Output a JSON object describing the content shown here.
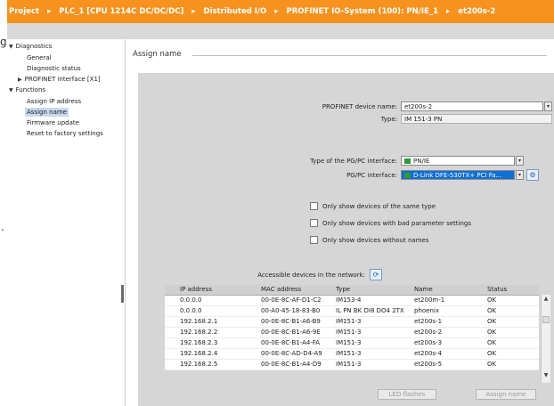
{
  "breadcrumb": [
    "Project",
    "PLC_1 [CPU 1214C DC/DC/DC]",
    "Distributed I/O",
    "PROFINET IO-System (100): PN/IE_1",
    "et200s-2"
  ],
  "breadcrumb_sep": "▸",
  "left_edge": {
    "top_char": "g",
    "mid_char": "."
  },
  "nav": {
    "diagnostics": "Diagnostics",
    "general": "General",
    "diagnostic_status": "Diagnostic status",
    "profinet_interface": "PROFINET interface [X1]",
    "functions": "Functions",
    "assign_ip": "Assign IP address",
    "assign_name": "Assign name",
    "firmware_update": "Firmware update",
    "reset_factory": "Reset to factory settings"
  },
  "section_title": "Assign name",
  "form": {
    "device_name_label": "PROFINET device name:",
    "device_name_value": "et200s-2",
    "type_label": "Type:",
    "type_value": "IM 151-3 PN",
    "pgpc_type_label": "Type of the PG/PC interface:",
    "pgpc_type_value": "PN/IE",
    "pgpc_interface_label": "PG/PC interface:",
    "pgpc_interface_value": "D-Link DFE-530TX+ PCI Fa..."
  },
  "checkboxes": {
    "same_type": "Only show devices of the same type",
    "bad_params": "Only show devices with bad parameter settings",
    "without_names": "Only show devices without names"
  },
  "accessible_label": "Accessible devices in the network:",
  "table": {
    "headers": [
      "IP address",
      "MAC address",
      "Type",
      "Name",
      "Status"
    ],
    "rows": [
      [
        "0.0.0.0",
        "00-0E-8C-AF-D1-C2",
        "IM153-4",
        "et200m-1",
        "OK"
      ],
      [
        "0.0.0.0",
        "00-A0-45-18-83-B0",
        "IL PN BK DI8 DO4 2TX",
        "phoenix",
        "OK"
      ],
      [
        "192.168.2.1",
        "00-0E-8C-B1-A6-B9",
        "IM151-3",
        "et200s-1",
        "OK"
      ],
      [
        "192.168.2.2",
        "00-0E-8C-B1-A6-9E",
        "IM151-3",
        "et200s-2",
        "OK"
      ],
      [
        "192.168.2.3",
        "00-0E-8C-B1-A4-FA",
        "IM151-3",
        "et200s-3",
        "OK"
      ],
      [
        "192.168.2.4",
        "00-0E-8C-AD-D4-A9",
        "IM151-3",
        "et200s-4",
        "OK"
      ],
      [
        "192.168.2.5",
        "00-0E-8C-B1-A4-D9",
        "IM151-3",
        "et200s-5",
        "OK"
      ]
    ]
  },
  "buttons": {
    "led_flashes": "LED flashes",
    "assign_name": "Assign name"
  },
  "icons": {
    "dropdown": "▾",
    "settings": "⚙",
    "refresh": "⟳",
    "scroll_up": "▲",
    "scroll_down": "▼",
    "nav_expanded": "▼",
    "nav_collapsed": "▶"
  },
  "colors": {
    "title_bar": "#f7921e",
    "selection": "#0f6fd6",
    "panel": "#d6d6d6"
  }
}
